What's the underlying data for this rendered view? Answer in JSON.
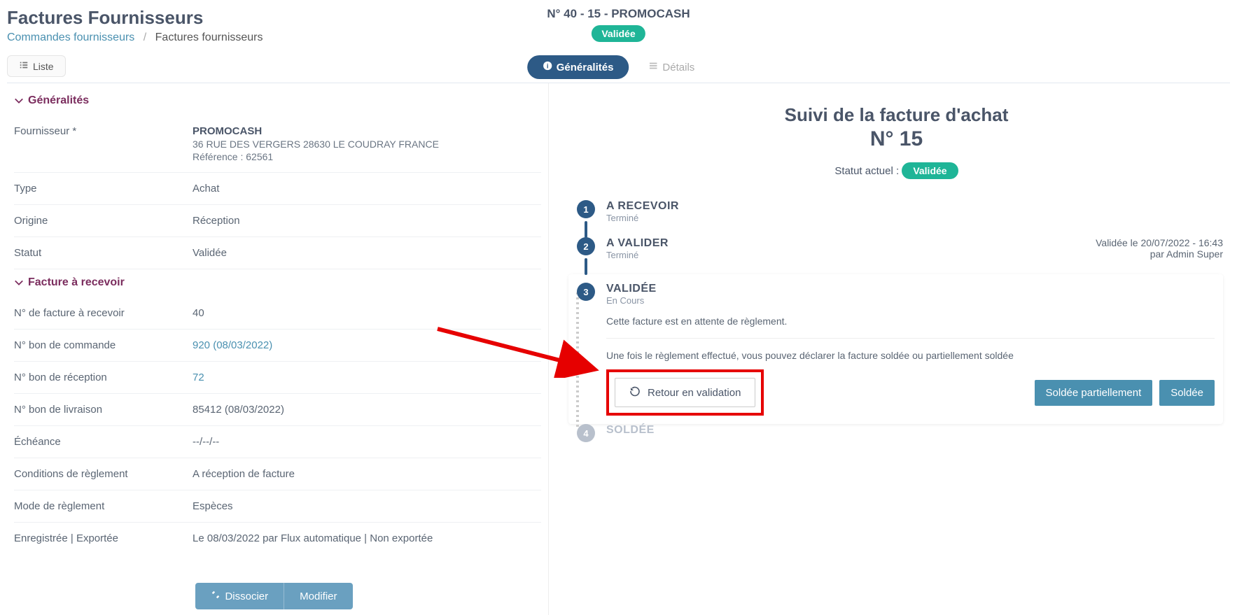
{
  "header": {
    "pageTitle": "Factures Fournisseurs",
    "breadcrumb": {
      "link": "Commandes fournisseurs",
      "current": "Factures fournisseurs"
    },
    "invoiceTitle": "N° 40 - 15 - PROMOCASH",
    "statusBadge": "Validée"
  },
  "topbar": {
    "listeLabel": "Liste",
    "tabs": {
      "generalites": "Généralités",
      "details": "Détails"
    }
  },
  "sections": {
    "generalites": {
      "title": "Généralités",
      "fields": {
        "fournisseurLabel": "Fournisseur *",
        "fournisseurName": "PROMOCASH",
        "fournisseurAddr": "36 RUE DES VERGERS 28630 LE COUDRAY FRANCE",
        "fournisseurRef": "Référence : 62561",
        "typeLabel": "Type",
        "typeValue": "Achat",
        "origineLabel": "Origine",
        "origineValue": "Réception",
        "statutLabel": "Statut",
        "statutValue": "Validée"
      }
    },
    "facture": {
      "title": "Facture à recevoir",
      "fields": {
        "numFactLabel": "N° de facture à recevoir",
        "numFactValue": "40",
        "bonCmdLabel": "N° bon de commande",
        "bonCmdValue": "920  (08/03/2022)",
        "bonRecLabel": "N° bon de réception",
        "bonRecValue": "72",
        "bonLivLabel": "N° bon de livraison",
        "bonLivValue": "85412  (08/03/2022)",
        "echeanceLabel": "Échéance",
        "echeanceValue": "--/--/--",
        "condLabel": "Conditions de règlement",
        "condValue": "A réception de facture",
        "modeLabel": "Mode de règlement",
        "modeValue": "Espèces",
        "enregLabel": "Enregistrée | Exportée",
        "enregValue": "Le 08/03/2022 par Flux automatique | Non exportée"
      }
    }
  },
  "actionBar": {
    "dissocier": "Dissocier",
    "modifier": "Modifier"
  },
  "tracking": {
    "title": "Suivi de la facture d'achat",
    "number": "N° 15",
    "statusLabel": "Statut actuel :",
    "statusValue": "Validée",
    "steps": {
      "s1": {
        "num": "1",
        "name": "A RECEVOIR",
        "status": "Terminé"
      },
      "s2": {
        "num": "2",
        "name": "A VALIDER",
        "status": "Terminé",
        "metaLine1": "Validée le 20/07/2022 - 16:43",
        "metaLine2": "par Admin Super"
      },
      "s3": {
        "num": "3",
        "name": "VALIDÉE",
        "status": "En Cours",
        "desc": "Cette facture est en attente de règlement.",
        "instr": "Une fois le règlement effectué, vous pouvez déclarer la facture soldée ou partiellement soldée",
        "retourBtn": "Retour en validation",
        "partielBtn": "Soldée partiellement",
        "soldeeBtn": "Soldée"
      },
      "s4": {
        "num": "4",
        "name": "SOLDÉE"
      }
    }
  }
}
